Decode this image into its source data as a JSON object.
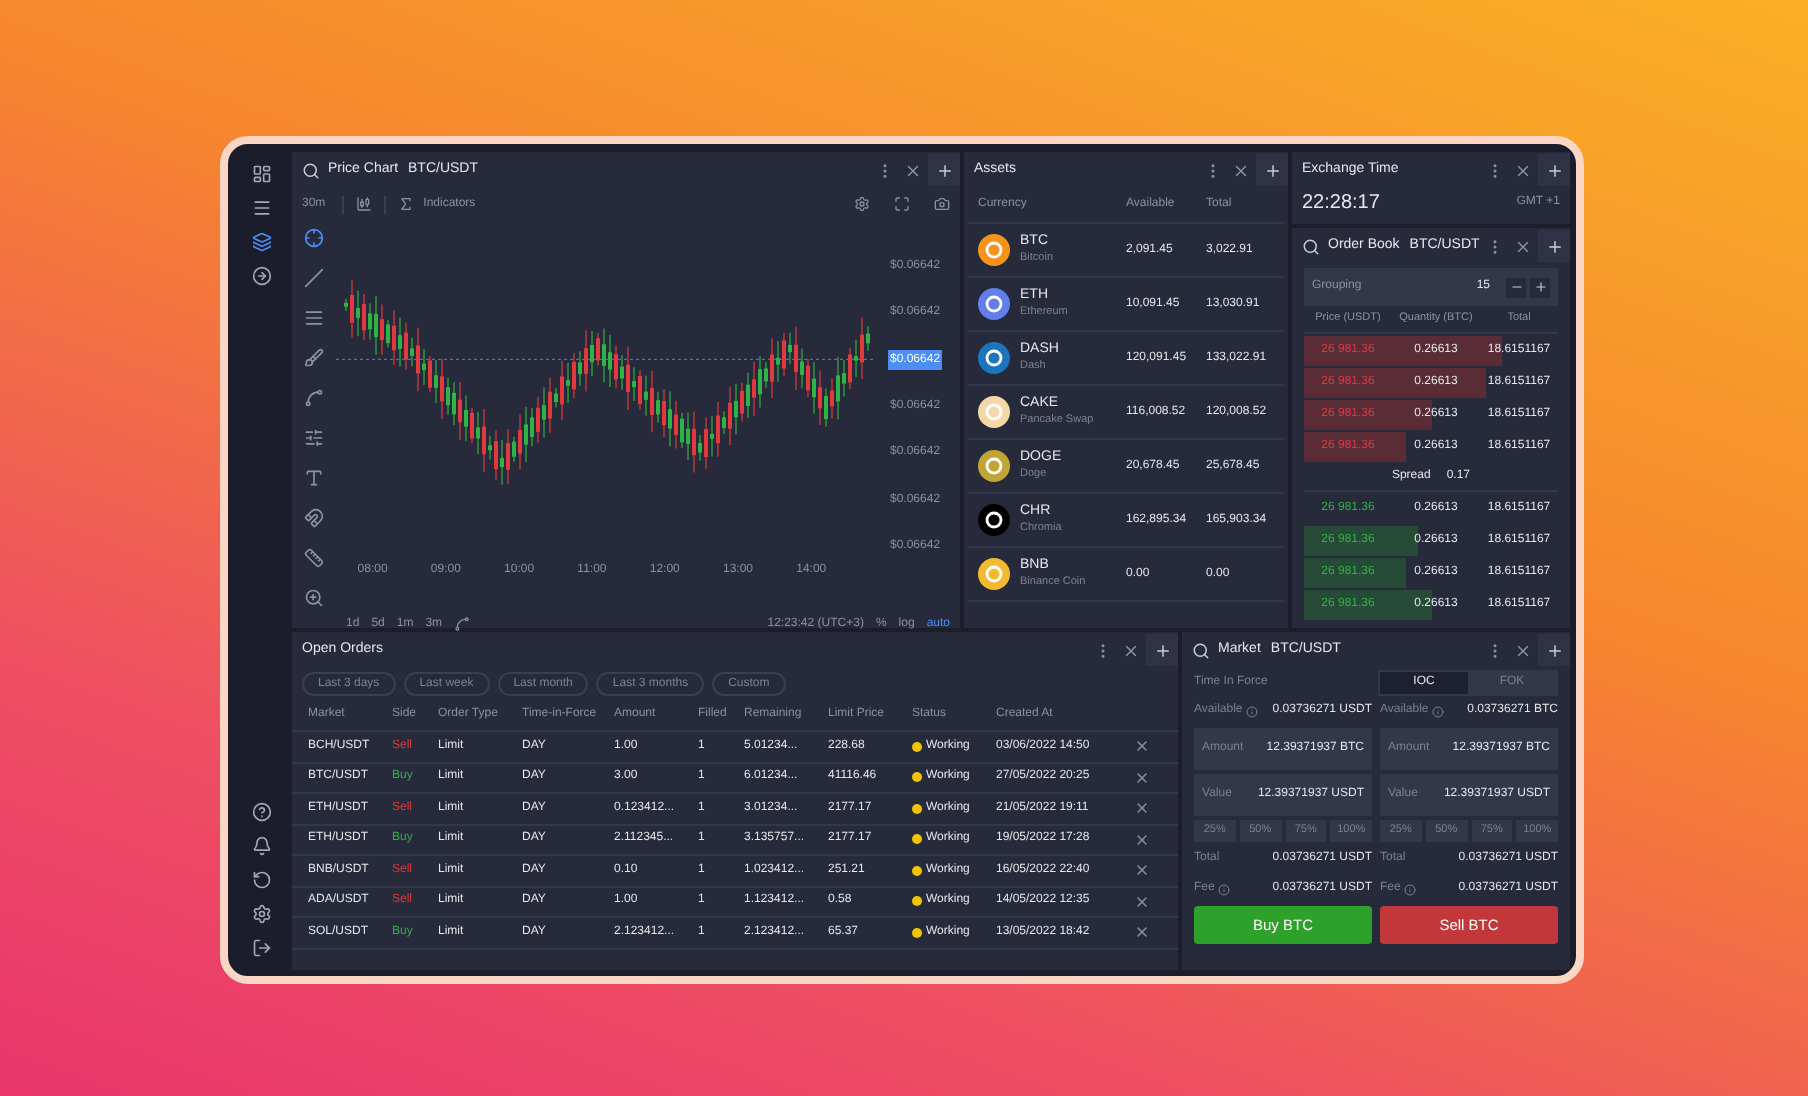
{
  "sidebar": {
    "top_items": [
      {
        "selected": false
      },
      {
        "selected": false
      },
      {
        "selected": true
      },
      {
        "selected": false
      }
    ],
    "bottom_items": [
      {
        "selected": false
      },
      {
        "selected": false
      },
      {
        "selected": false
      },
      {
        "selected": false
      },
      {
        "selected": false
      }
    ]
  },
  "price_chart": {
    "title": "Price Chart",
    "pair": "BTC/USDT",
    "interval": "30m",
    "indicators": "Indicators",
    "tools": [
      {
        "selected": true
      },
      {
        "selected": false
      },
      {
        "selected": false
      },
      {
        "selected": false
      },
      {
        "selected": false
      },
      {
        "selected": false
      },
      {
        "selected": false
      },
      {
        "selected": false
      },
      {
        "selected": false
      },
      {
        "selected": false
      }
    ],
    "price_labels": [
      {
        "text": "$0.06642",
        "current": false
      },
      {
        "text": "$0.06642",
        "current": false
      },
      {
        "text": "$0.06642",
        "current": true
      },
      {
        "text": "$0.06642",
        "current": false
      },
      {
        "text": "$0.06642",
        "current": false
      },
      {
        "text": "$0.06642",
        "current": false
      },
      {
        "text": "$0.06642",
        "current": false
      }
    ],
    "time_labels": [
      "08:00",
      "09:00",
      "10:00",
      "11:00",
      "12:00",
      "13:00",
      "14:00"
    ],
    "ranges": [
      "1d",
      "5d",
      "1m",
      "3m"
    ],
    "clock": "12:23:42 (UTC+3)",
    "scale_options": [
      {
        "label": "%",
        "selected": false
      },
      {
        "label": "log",
        "selected": false
      },
      {
        "label": "auto",
        "selected": true
      }
    ]
  },
  "assets": {
    "title": "Assets",
    "columns": [
      "Currency",
      "Available",
      "Total"
    ],
    "rows": [
      {
        "symbol": "BTC",
        "name": "Bitcoin",
        "available": "2,091.45",
        "total": "3,022.91",
        "color": "#f7931a"
      },
      {
        "symbol": "ETH",
        "name": "Ethereum",
        "available": "10,091.45",
        "total": "13,030.91",
        "color": "#627eea"
      },
      {
        "symbol": "DASH",
        "name": "Dash",
        "available": "120,091.45",
        "total": "133,022.91",
        "color": "#1c75bc"
      },
      {
        "symbol": "CAKE",
        "name": "Pancake Swap",
        "available": "116,008.52",
        "total": "120,008.52",
        "color": "#f4d8a8"
      },
      {
        "symbol": "DOGE",
        "name": "Doge",
        "available": "20,678.45",
        "total": "25,678.45",
        "color": "#c2a633"
      },
      {
        "symbol": "CHR",
        "name": "Chromia",
        "available": "162,895.34",
        "total": "165,903.34",
        "color": "#000000"
      },
      {
        "symbol": "BNB",
        "name": "Binance Coin",
        "available": "0.00",
        "total": "0.00",
        "color": "#f3ba2f"
      }
    ]
  },
  "exchange_time": {
    "title": "Exchange Time",
    "time": "22:28:17",
    "zone": "GMT +1"
  },
  "order_book": {
    "title": "Order Book",
    "pair": "BTC/USDT",
    "grouping_label": "Grouping",
    "grouping_value": "15",
    "columns": [
      "Price (USDT)",
      "Quantity (BTC)",
      "Total"
    ],
    "asks": [
      {
        "price": "26 981.36",
        "quantity": "0.26613",
        "total": "18.6151167"
      },
      {
        "price": "26 981.36",
        "quantity": "0.26613",
        "total": "18.6151167"
      },
      {
        "price": "26 981.36",
        "quantity": "0.26613",
        "total": "18.6151167"
      },
      {
        "price": "26 981.36",
        "quantity": "0.26613",
        "total": "18.6151167"
      }
    ],
    "spread_label": "Spread",
    "spread_value": "0.17",
    "bids": [
      {
        "price": "26 981.36",
        "quantity": "0.26613",
        "total": "18.6151167"
      },
      {
        "price": "26 981.36",
        "quantity": "0.26613",
        "total": "18.6151167"
      },
      {
        "price": "26 981.36",
        "quantity": "0.26613",
        "total": "18.6151167"
      },
      {
        "price": "26 981.36",
        "quantity": "0.26613",
        "total": "18.6151167"
      }
    ]
  },
  "open_orders": {
    "title": "Open Orders",
    "filters": [
      "Last 3 days",
      "Last week",
      "Last month",
      "Last 3 months",
      "Custom"
    ],
    "columns": [
      "Market",
      "Side",
      "Order Type",
      "Time-in-Force",
      "Amount",
      "Filled",
      "Remaining",
      "Limit Price",
      "Status",
      "Created At"
    ],
    "rows": [
      {
        "market": "BCH/USDT",
        "side": "Sell",
        "kind": "sell",
        "type": "Limit",
        "tif": "DAY",
        "amount": "1.00",
        "filled": "1",
        "remaining": "5.01234...",
        "limit_price": "228.68",
        "status": "Working",
        "created": "03/06/2022 14:50"
      },
      {
        "market": "BTC/USDT",
        "side": "Buy",
        "kind": "buy",
        "type": "Limit",
        "tif": "DAY",
        "amount": "3.00",
        "filled": "1",
        "remaining": "6.01234...",
        "limit_price": "41116.46",
        "status": "Working",
        "created": "27/05/2022 20:25"
      },
      {
        "market": "ETH/USDT",
        "side": "Sell",
        "kind": "sell",
        "type": "Limit",
        "tif": "DAY",
        "amount": "0.123412...",
        "filled": "1",
        "remaining": "3.01234...",
        "limit_price": "2177.17",
        "status": "Working",
        "created": "21/05/2022 19:11"
      },
      {
        "market": "ETH/USDT",
        "side": "Buy",
        "kind": "buy",
        "type": "Limit",
        "tif": "DAY",
        "amount": "2.112345...",
        "filled": "1",
        "remaining": "3.135757...",
        "limit_price": "2177.17",
        "status": "Working",
        "created": "19/05/2022 17:28"
      },
      {
        "market": "BNB/USDT",
        "side": "Sell",
        "kind": "sell",
        "type": "Limit",
        "tif": "DAY",
        "amount": "0.10",
        "filled": "1",
        "remaining": "1.023412...",
        "limit_price": "251.21",
        "status": "Working",
        "created": "16/05/2022 22:40"
      },
      {
        "market": "ADA/USDT",
        "side": "Sell",
        "kind": "sell",
        "type": "Limit",
        "tif": "DAY",
        "amount": "1.00",
        "filled": "1",
        "remaining": "1.123412...",
        "limit_price": "0.58",
        "status": "Working",
        "created": "14/05/2022 12:35"
      },
      {
        "market": "SOL/USDT",
        "side": "Buy",
        "kind": "buy",
        "type": "Limit",
        "tif": "DAY",
        "amount": "2.123412...",
        "filled": "1",
        "remaining": "2.123412...",
        "limit_price": "65.37",
        "status": "Working",
        "created": "13/05/2022 18:42"
      }
    ]
  },
  "market": {
    "title": "Market",
    "pair": "BTC/USDT",
    "tif_label": "Time In Force",
    "tif_options": [
      {
        "label": "IOC",
        "selected": true
      },
      {
        "label": "FOK",
        "selected": false
      }
    ],
    "sides": [
      {
        "kind": "buy",
        "available_label": "Available",
        "available": "0.03736271 USDT",
        "amount_label": "Amount",
        "amount": "12.39371937 BTC",
        "value_label": "Value",
        "value": "12.39371937 USDT",
        "percents": [
          "25%",
          "50%",
          "75%",
          "100%"
        ],
        "total_label": "Total",
        "total": "0.03736271 USDT",
        "fee_label": "Fee",
        "fee": "0.03736271 USDT",
        "button": "Buy BTC"
      },
      {
        "kind": "sell",
        "available_label": "Available",
        "available": "0.03736271 BTC",
        "amount_label": "Amount",
        "amount": "12.39371937 BTC",
        "value_label": "Value",
        "value": "12.39371937 USDT",
        "percents": [
          "25%",
          "50%",
          "75%",
          "100%"
        ],
        "total_label": "Total",
        "total": "0.03736271 USDT",
        "fee_label": "Fee",
        "fee": "0.03736271 USDT",
        "button": "Sell BTC"
      }
    ]
  }
}
